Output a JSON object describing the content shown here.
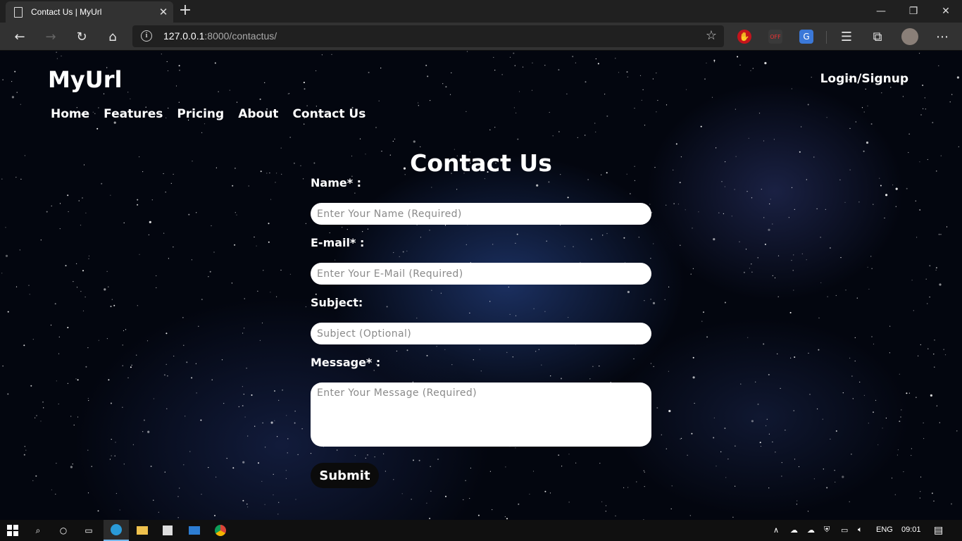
{
  "browser": {
    "tab_title": "Contact Us | MyUrl",
    "url_host": "127.0.0.1",
    "url_rest": ":8000/contactus/",
    "window_controls": [
      "minimize-icon",
      "restore-icon",
      "close-icon"
    ],
    "extensions": [
      "adblock-icon",
      "off-extension-icon",
      "translate-icon"
    ],
    "toolbar_icons": [
      "favorites-icon",
      "collections-icon",
      "profile-avatar",
      "more-icon"
    ]
  },
  "site": {
    "brand": "MyUrl",
    "login": "Login/Signup",
    "nav": [
      "Home",
      "Features",
      "Pricing",
      "About",
      "Contact Us"
    ]
  },
  "form": {
    "heading": "Contact Us",
    "name_label": "Name* :",
    "name_placeholder": "Enter Your Name (Required)",
    "email_label": "E-mail* :",
    "email_placeholder": "Enter Your E-Mail (Required)",
    "subject_label": "Subject:",
    "subject_placeholder": "Subject (Optional)",
    "message_label": "Message* :",
    "message_placeholder": "Enter Your Message (Required)",
    "submit": "Submit"
  },
  "taskbar": {
    "language": "ENG",
    "time": "09:01"
  },
  "colors": {
    "background": "#03060f",
    "input_bg": "#ffffff",
    "button_bg": "#0b0b0b",
    "text": "#ffffff"
  }
}
